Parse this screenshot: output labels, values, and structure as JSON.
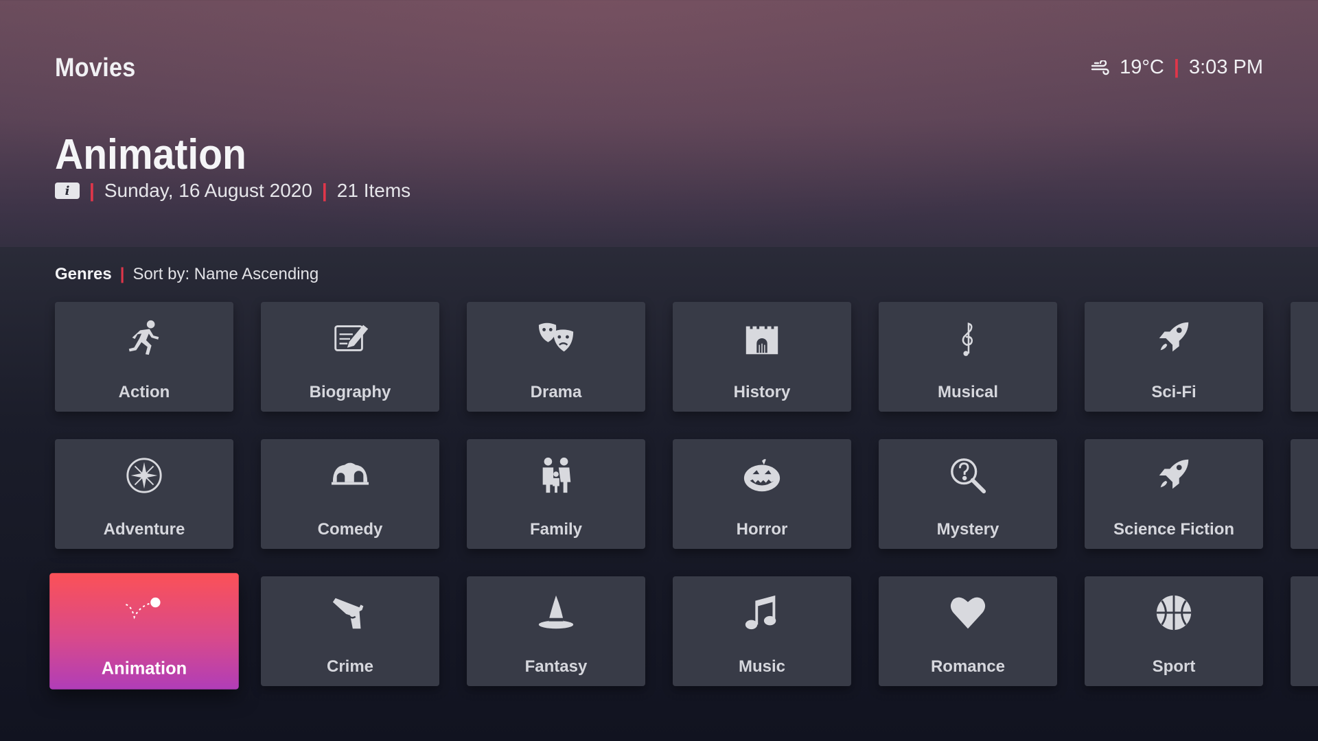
{
  "header": {
    "section": "Movies",
    "weather_icon": "wind-icon",
    "temperature": "19°C",
    "time": "3:03 PM"
  },
  "page": {
    "title": "Animation",
    "info_icon": "info-icon",
    "info_glyph": "i",
    "date": "Sunday, 16 August 2020",
    "count": "21 Items"
  },
  "filter": {
    "label": "Genres",
    "sort": "Sort by: Name Ascending"
  },
  "colors": {
    "accent_separator": "#e0364a",
    "focus_gradient_top": "#fb5157",
    "focus_gradient_bottom": "#b03db8",
    "tile_bg": "#383b47"
  },
  "genres": [
    {
      "label": "Action",
      "icon": "running-man-icon"
    },
    {
      "label": "Biography",
      "icon": "notepad-pencil-icon"
    },
    {
      "label": "Drama",
      "icon": "theater-masks-icon"
    },
    {
      "label": "History",
      "icon": "castle-icon"
    },
    {
      "label": "Musical",
      "icon": "treble-clef-icon"
    },
    {
      "label": "Sci-Fi",
      "icon": "rocket-icon"
    },
    {
      "label": "Adventure",
      "icon": "compass-icon"
    },
    {
      "label": "Comedy",
      "icon": "circus-tent-icon"
    },
    {
      "label": "Family",
      "icon": "family-icon"
    },
    {
      "label": "Horror",
      "icon": "pumpkin-icon"
    },
    {
      "label": "Mystery",
      "icon": "magnifier-question-icon"
    },
    {
      "label": "Science Fiction",
      "icon": "rocket-icon"
    },
    {
      "label": "Animation",
      "icon": "bouncing-ball-icon",
      "focused": true
    },
    {
      "label": "Crime",
      "icon": "pistol-icon"
    },
    {
      "label": "Fantasy",
      "icon": "wizard-hat-icon"
    },
    {
      "label": "Music",
      "icon": "music-note-icon"
    },
    {
      "label": "Romance",
      "icon": "heart-icon"
    },
    {
      "label": "Sport",
      "icon": "basketball-icon"
    }
  ]
}
